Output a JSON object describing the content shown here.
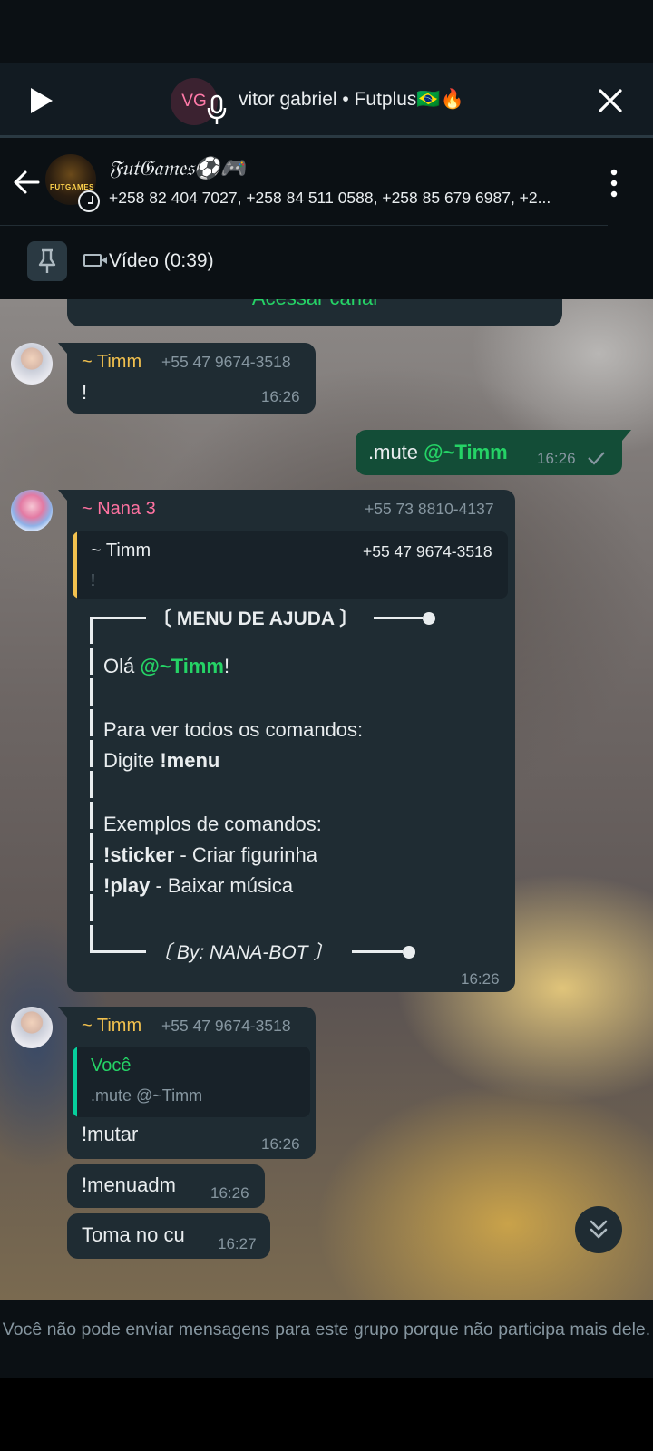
{
  "call": {
    "avatar_initials": "VG",
    "title": "vitor gabriel • Futplus🇧🇷🔥"
  },
  "header": {
    "group_name": "𝔉𝔲𝔱𝔊𝔞𝔪𝔢𝔰⚽🎮",
    "members": "+258 82 404 7027, +258 84 511 0588, +258 85 679 6987, +2...",
    "avatar_text": "FUTGAMES"
  },
  "pinned": {
    "label": "Vídeo (0:39)"
  },
  "channel_card": {
    "label": "Acessar canal"
  },
  "messages": [
    {
      "sender": "~ Timm",
      "phone": "+55 47 9674-3518",
      "text": "!",
      "time": "16:26"
    },
    {
      "outgoing": true,
      "text_prefix": ".mute ",
      "mention": "@~Timm",
      "time": "16:26"
    },
    {
      "sender": "~ Nana 3",
      "phone": "+55 73 8810-4137",
      "quote": {
        "name": "~ Timm",
        "phone": "+55 47 9674-3518",
        "text": "!"
      },
      "menu": {
        "title": "〔 MENU DE AJUDA 〕",
        "greeting_prefix": "Olá ",
        "greeting_mention": "@~Timm",
        "greeting_suffix": "!",
        "line1": "Para ver todos os comandos:",
        "line2_prefix": "Digite ",
        "line2_cmd": "!menu",
        "line3": "Exemplos de comandos:",
        "cmd1": "!sticker",
        "cmd1_desc": " - Criar figurinha",
        "cmd2": "!play",
        "cmd2_desc": " - Baixar música",
        "footer": "〔 By: NANA-BOT 〕"
      },
      "time": "16:26"
    },
    {
      "sender": "~ Timm",
      "phone": "+55 47 9674-3518",
      "quote": {
        "name": "Você",
        "text": ".mute @~Timm"
      },
      "text": "!mutar",
      "time": "16:26"
    },
    {
      "text": "!menuadm",
      "time": "16:26"
    },
    {
      "text": "Toma no cu",
      "time": "16:27"
    }
  ],
  "footer": {
    "text": "Você não pode enviar mensagens para este grupo porque não participa mais dele."
  },
  "colors": {
    "background": "#0b1014",
    "bubble_in": "#1f2c33",
    "bubble_out": "#134d37",
    "accent_green": "#25d366",
    "name_timm": "#f2c14e",
    "name_nana": "#ff72a1",
    "muted_text": "#8696a0"
  },
  "icons": [
    "play-icon",
    "mic-icon",
    "close-icon",
    "back-arrow-icon",
    "timer-icon",
    "more-vertical-icon",
    "pin-icon",
    "video-icon",
    "double-chevron-down-icon",
    "checkmark-icon"
  ]
}
